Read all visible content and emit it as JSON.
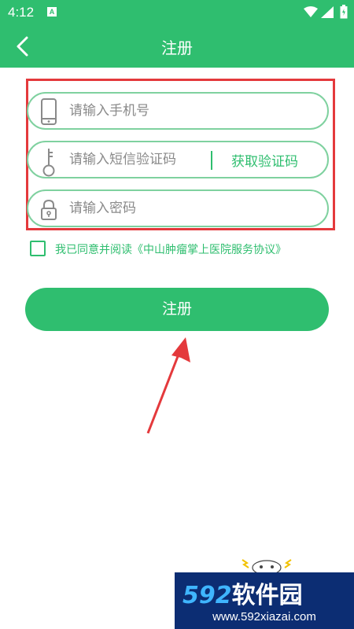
{
  "status_bar": {
    "time": "4:12",
    "notification_icon": "A",
    "icons": [
      "wifi-icon",
      "signal-icon",
      "battery-icon"
    ]
  },
  "app_bar": {
    "back_icon": "chevron-left-icon",
    "title": "注册"
  },
  "form": {
    "phone": {
      "placeholder": "请输入手机号",
      "icon": "phone-icon"
    },
    "sms_code": {
      "placeholder": "请输入短信验证码",
      "icon": "key-icon",
      "button_label": "获取验证码"
    },
    "password": {
      "placeholder": "请输入密码",
      "icon": "lock-icon"
    }
  },
  "agreement": {
    "prefix": "我已同意并阅读",
    "link": "《中山肿瘤掌上医院服务协议》",
    "checked": false
  },
  "register_button": {
    "label": "注册"
  },
  "watermark": {
    "number": "592",
    "brand": "软件园",
    "url": "www.592xiazai.com"
  },
  "colors": {
    "primary": "#2fbe6f",
    "field_border": "#7fd19f",
    "annotation": "#e4393c",
    "watermark_bg": "#0c2d73"
  }
}
